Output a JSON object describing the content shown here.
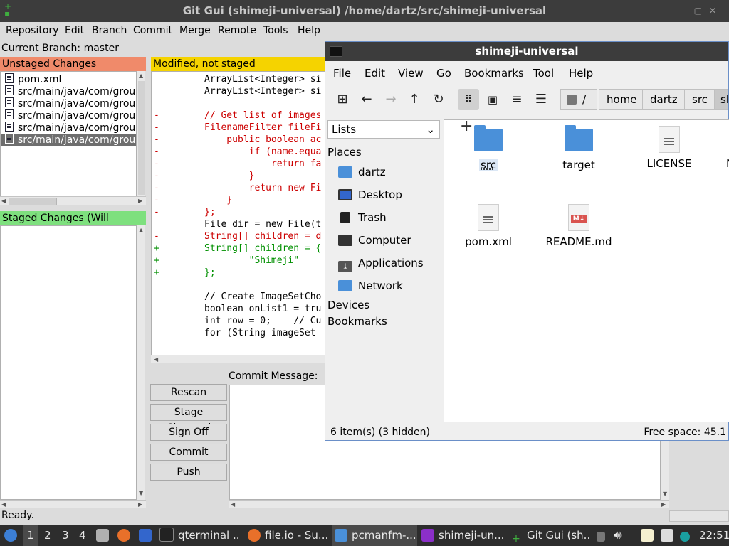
{
  "gitgui": {
    "title": "Git Gui (shimeji-universal) /home/dartz/src/shimeji-universal",
    "menu": [
      "Repository",
      "Edit",
      "Branch",
      "Commit",
      "Merge",
      "Remote",
      "Tools",
      "Help"
    ],
    "current_branch": "Current Branch: master",
    "unstaged_header": "Unstaged Changes",
    "unstaged_files": [
      "pom.xml",
      "src/main/java/com/group",
      "src/main/java/com/group",
      "src/main/java/com/group",
      "src/main/java/com/group",
      "src/main/java/com/group"
    ],
    "staged_header": "Staged Changes (Will Commit)",
    "diff_header": "Modified, not staged",
    "diff_lines": [
      {
        "m": "",
        "t": "ArrayList<Integer> si",
        "k": "ctx"
      },
      {
        "m": "",
        "t": "ArrayList<Integer> si",
        "k": "ctx"
      },
      {
        "m": "",
        "t": "",
        "k": "ctx"
      },
      {
        "m": "-",
        "t": "// Get list of images",
        "k": "del"
      },
      {
        "m": "-",
        "t": "FilenameFilter fileFi",
        "k": "del"
      },
      {
        "m": "-",
        "t": "    public boolean ac",
        "k": "del"
      },
      {
        "m": "-",
        "t": "        if (name.equa",
        "k": "del"
      },
      {
        "m": "-",
        "t": "            return fa",
        "k": "del"
      },
      {
        "m": "-",
        "t": "        }",
        "k": "del"
      },
      {
        "m": "-",
        "t": "        return new Fi",
        "k": "del"
      },
      {
        "m": "-",
        "t": "    }",
        "k": "del"
      },
      {
        "m": "-",
        "t": "};",
        "k": "del"
      },
      {
        "m": "",
        "t": "File dir = new File(t",
        "k": "ctx"
      },
      {
        "m": "-",
        "t": "String[] children = d",
        "k": "del"
      },
      {
        "m": "+",
        "t": "String[] children = {",
        "k": "add"
      },
      {
        "m": "+",
        "t": "        \"Shimeji\"",
        "k": "add"
      },
      {
        "m": "+",
        "t": "};",
        "k": "add"
      },
      {
        "m": "",
        "t": "",
        "k": "ctx"
      },
      {
        "m": "",
        "t": "// Create ImageSetCho",
        "k": "ctx"
      },
      {
        "m": "",
        "t": "boolean onList1 = tru",
        "k": "ctx"
      },
      {
        "m": "",
        "t": "int row = 0;    // Cu",
        "k": "ctx"
      },
      {
        "m": "",
        "t": "for (String imageSet ",
        "k": "ctx"
      }
    ],
    "commit_message_label": "Commit Message:",
    "buttons": [
      "Rescan",
      "Stage Changed",
      "Sign Off",
      "Commit",
      "Push"
    ],
    "status": "Ready."
  },
  "filemanager": {
    "title": "shimeji-universal",
    "menu": [
      "File",
      "Edit",
      "View",
      "Go",
      "Bookmarks",
      "Tool",
      "Help"
    ],
    "path": [
      "/",
      "home",
      "dartz",
      "src",
      "sh"
    ],
    "side_mode": "Lists",
    "places_header": "Places",
    "places": [
      {
        "label": "dartz",
        "icon": "home-folder-icon"
      },
      {
        "label": "Desktop",
        "icon": "desktop-icon"
      },
      {
        "label": "Trash",
        "icon": "trash-icon"
      },
      {
        "label": "Computer",
        "icon": "computer-icon"
      },
      {
        "label": "Applications",
        "icon": "applications-icon"
      },
      {
        "label": "Network",
        "icon": "network-icon"
      }
    ],
    "devices_header": "Devices",
    "bookmarks_header": "Bookmarks",
    "items": [
      {
        "name": "src",
        "type": "folder"
      },
      {
        "name": "target",
        "type": "folder"
      },
      {
        "name": "LICENSE",
        "type": "file"
      },
      {
        "name": "pom.xml",
        "type": "file"
      },
      {
        "name": "README.md",
        "type": "markdown"
      }
    ],
    "status_left": "6 item(s) (3 hidden)",
    "status_right": "Free space: 45.1"
  },
  "taskbar": {
    "workspaces": [
      "1",
      "2",
      "3",
      "4"
    ],
    "tasks": [
      "qterminal ...",
      "file.io - Su...",
      "pcmanfm-...",
      "shimeji-un...",
      "Git Gui (sh..."
    ],
    "clock": "22:51"
  }
}
